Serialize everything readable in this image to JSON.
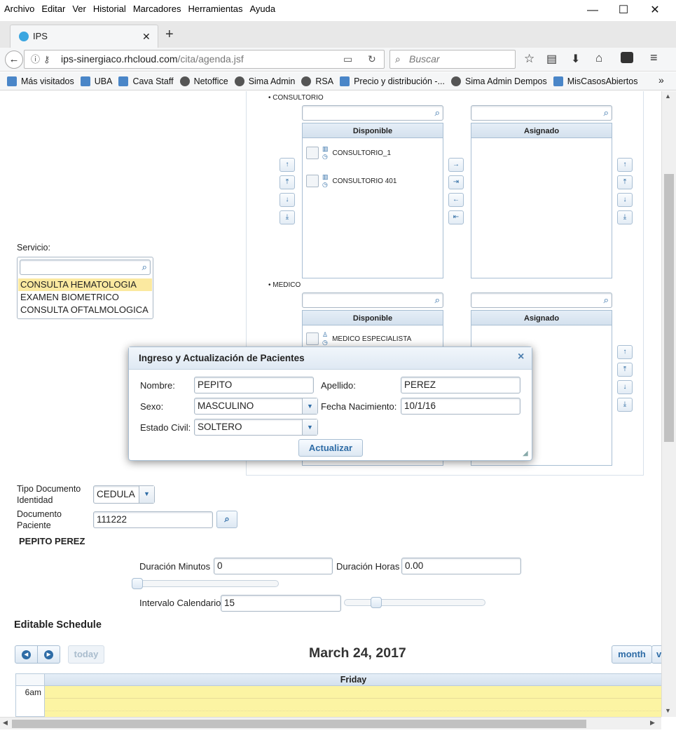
{
  "menu": [
    "Archivo",
    "Editar",
    "Ver",
    "Historial",
    "Marcadores",
    "Herramientas",
    "Ayuda"
  ],
  "window": {
    "minimize": "—",
    "maximize": "☐",
    "close": "✕"
  },
  "tab": {
    "title": "IPS",
    "close": "✕",
    "new_tab": "+"
  },
  "nav": {
    "url_host": "ips-sinergiaco.rhcloud.com",
    "url_path": "/cita/agenda.jsf",
    "search_placeholder": "Buscar"
  },
  "bookmarks": [
    "Más visitados",
    "UBA",
    "Cava Staff",
    "Netoffice",
    "Sima Admin",
    "RSA",
    "Precio y distribución -...",
    "Sima Admin Dempos",
    "MisCasosAbiertos"
  ],
  "bookmarks_overflow": "»",
  "picklists": {
    "consultorio": {
      "title": "CONSULTORIO",
      "source_header": "Disponible",
      "target_header": "Asignado",
      "items": [
        "CONSULTORIO_1",
        "CONSULTORIO 401"
      ]
    },
    "medico": {
      "title": "MEDICO",
      "source_header": "Disponible",
      "target_header": "Asignado",
      "items": [
        "MEDICO ESPECIALISTA"
      ]
    }
  },
  "servicio": {
    "label": "Servicio:",
    "options": [
      "CONSULTA HEMATOLOGIA",
      "EXAMEN BIOMETRICO",
      "CONSULTA OFTALMOLOGICA"
    ],
    "selected": "CONSULTA HEMATOLOGIA"
  },
  "dialog": {
    "title": "Ingreso y Actualización de Pacientes",
    "close": "×",
    "nombre_label": "Nombre:",
    "nombre": "PEPITO",
    "apellido_label": "Apellido:",
    "apellido": "PEREZ",
    "sexo_label": "Sexo:",
    "sexo": "MASCULINO",
    "fecha_label": "Fecha Nacimiento:",
    "fecha": "10/1/16",
    "estado_label": "Estado Civil:",
    "estado": "SOLTERO",
    "submit": "Actualizar"
  },
  "documento": {
    "tipo_label_1": "Tipo Documento",
    "tipo_label_2": "Identidad",
    "tipo": "CEDULA",
    "doc_label_1": "Documento",
    "doc_label_2": "Paciente",
    "doc": "111222",
    "patient_name": "PEPITO PEREZ"
  },
  "duracion": {
    "min_label": "Duración Minutos",
    "min": "0",
    "horas_label": "Duración Horas",
    "horas": "0.00",
    "intervalo_label": "Intervalo Calendario",
    "intervalo": "15",
    "min_slider": 0.0,
    "intervalo_slider": 0.2
  },
  "schedule": {
    "title": "Editable Schedule",
    "date": "March 24, 2017",
    "today": "today",
    "month": "month",
    "next_view": "v",
    "day": "Friday",
    "time": "6am"
  },
  "colors": {
    "accent": "#2e6ca6",
    "highlight": "#fbe9a0",
    "calendar_today": "#fcf4a3"
  }
}
